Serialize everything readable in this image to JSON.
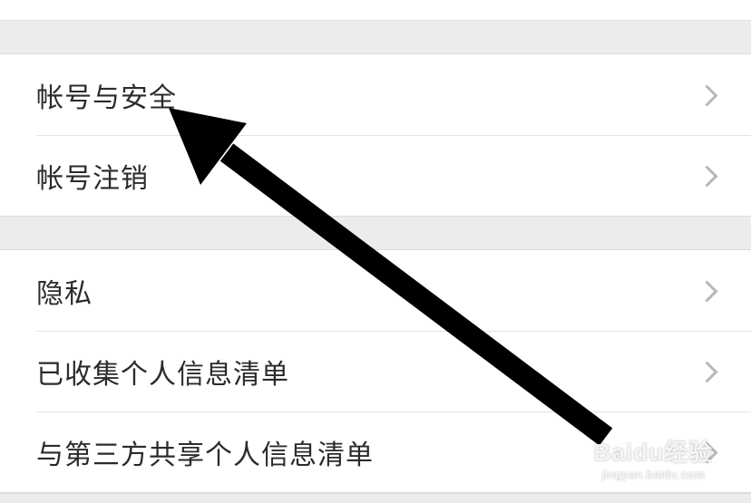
{
  "settings": {
    "groups": [
      {
        "items": [
          {
            "label": "帐号与安全",
            "icon": "chevron-right-icon"
          },
          {
            "label": "帐号注销",
            "icon": "chevron-right-icon"
          }
        ]
      },
      {
        "items": [
          {
            "label": "隐私",
            "icon": "chevron-right-icon"
          },
          {
            "label": "已收集个人信息清单",
            "icon": "chevron-right-icon"
          },
          {
            "label": "与第三方共享个人信息清单",
            "icon": "chevron-right-icon"
          }
        ]
      }
    ]
  },
  "overlay": {
    "arrow_color": "#000000"
  },
  "watermark": {
    "logo_text": "Baidu经验",
    "url_text": "jingyan.baidu.com"
  },
  "colors": {
    "section_gap": "#ececec",
    "separator": "#dcdcdc",
    "label_text": "#2b2b2b",
    "chevron": "#b8b8b8"
  }
}
